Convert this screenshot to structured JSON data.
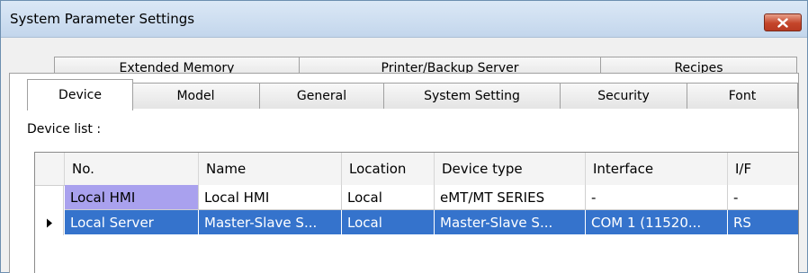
{
  "window": {
    "title": "System Parameter Settings"
  },
  "tabs": {
    "back_row": [
      "Extended Memory",
      "Printer/Backup Server",
      "Recipes"
    ],
    "front_row": [
      "Device",
      "Model",
      "General",
      "System Setting",
      "Security",
      "Font"
    ],
    "active": "Device"
  },
  "device_list": {
    "label": "Device list :",
    "columns": [
      "No.",
      "Name",
      "Location",
      "Device type",
      "Interface",
      "I/F"
    ],
    "rows": [
      {
        "no": "Local HMI",
        "name": "Local HMI",
        "location": "Local",
        "device_type": "eMT/MT SERIES",
        "interface": "-",
        "if": "-"
      },
      {
        "no": "Local Server",
        "name": "Master-Slave S...",
        "location": "Local",
        "device_type": "Master-Slave S...",
        "interface": "COM 1 (11520...",
        "if": "RS"
      }
    ],
    "selected_row": 1
  },
  "colors": {
    "selected_row": "#3573cc",
    "highlight_cell": "#a9a1ee",
    "close_button": "#c4452a"
  }
}
